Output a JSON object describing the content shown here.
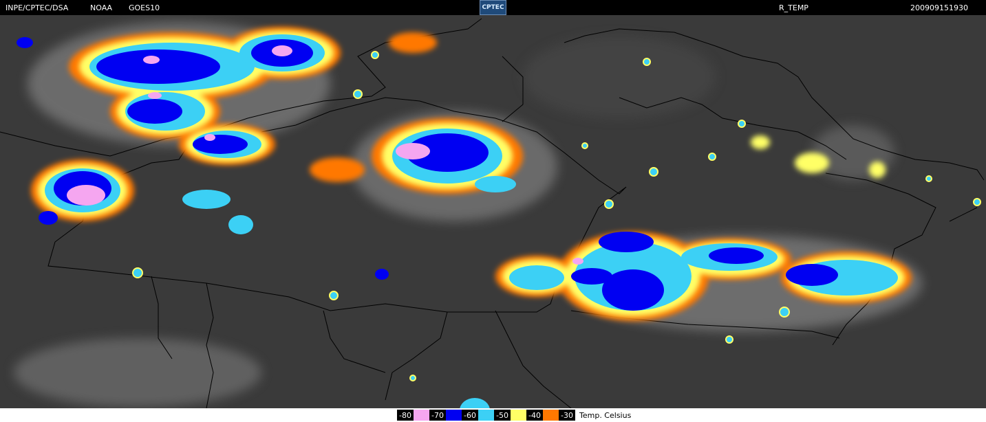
{
  "header": {
    "org": "INPE/CPTEC/DSA",
    "agency": "NOAA",
    "satellite": "GOES10",
    "logo_text": "CPTEC",
    "product": "R_TEMP",
    "timestamp": "200909151930"
  },
  "legend": {
    "items": [
      {
        "label": "-80",
        "color": "#f5a6f0"
      },
      {
        "label": "-70",
        "color": "#0000f2"
      },
      {
        "label": "-60",
        "color": "#3cd0f5"
      },
      {
        "label": "-50",
        "color": "#ffff66"
      },
      {
        "label": "-40",
        "color": "#ff7800"
      },
      {
        "label": "-30",
        "color": "#8c8c8c"
      }
    ],
    "caption": "Temp. Celsius"
  },
  "colors": {
    "background": "#000000",
    "map_base": "#3e3e3e",
    "cloud_gray": "#a9a9a9",
    "border_lines": "#000000"
  }
}
